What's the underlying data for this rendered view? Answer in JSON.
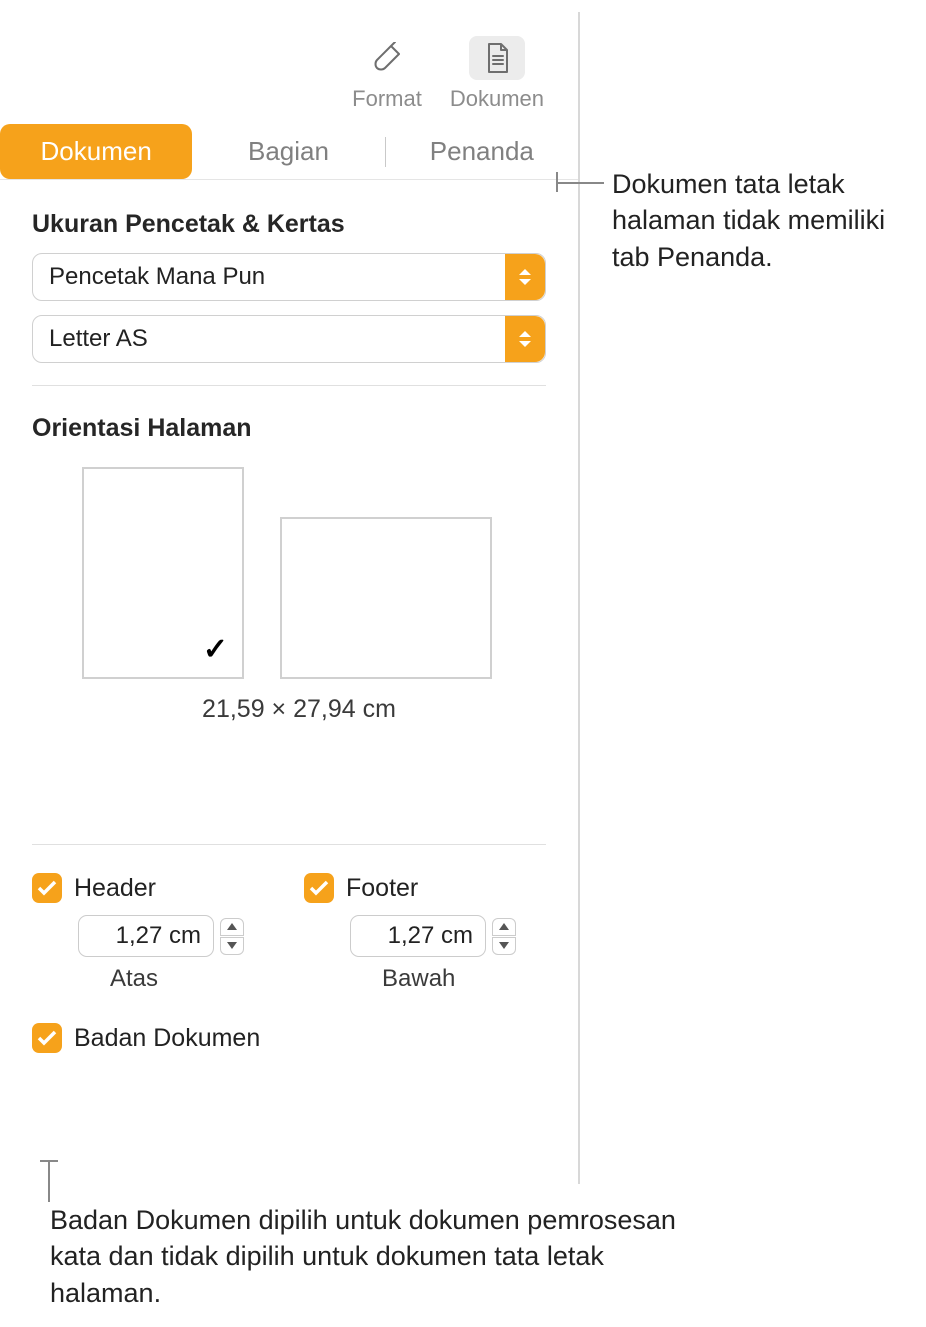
{
  "toolbar": {
    "format_label": "Format",
    "document_label": "Dokumen"
  },
  "tabs": {
    "document": "Dokumen",
    "section": "Bagian",
    "bookmarks": "Penanda"
  },
  "printer_section": {
    "title": "Ukuran Pencetak & Kertas",
    "printer_value": "Pencetak Mana Pun",
    "paper_value": "Letter AS"
  },
  "orientation": {
    "title": "Orientasi Halaman",
    "dimensions": "21,59 × 27,94 cm"
  },
  "header": {
    "label": "Header",
    "value": "1,27 cm",
    "caption": "Atas"
  },
  "footer": {
    "label": "Footer",
    "value": "1,27 cm",
    "caption": "Bawah"
  },
  "document_body": {
    "label": "Badan Dokumen"
  },
  "callouts": {
    "bookmarks": "Dokumen tata letak halaman tidak memiliki tab Penanda.",
    "body": "Badan Dokumen dipilih untuk dokumen pemrosesan kata dan tidak dipilih untuk dokumen tata letak halaman."
  }
}
